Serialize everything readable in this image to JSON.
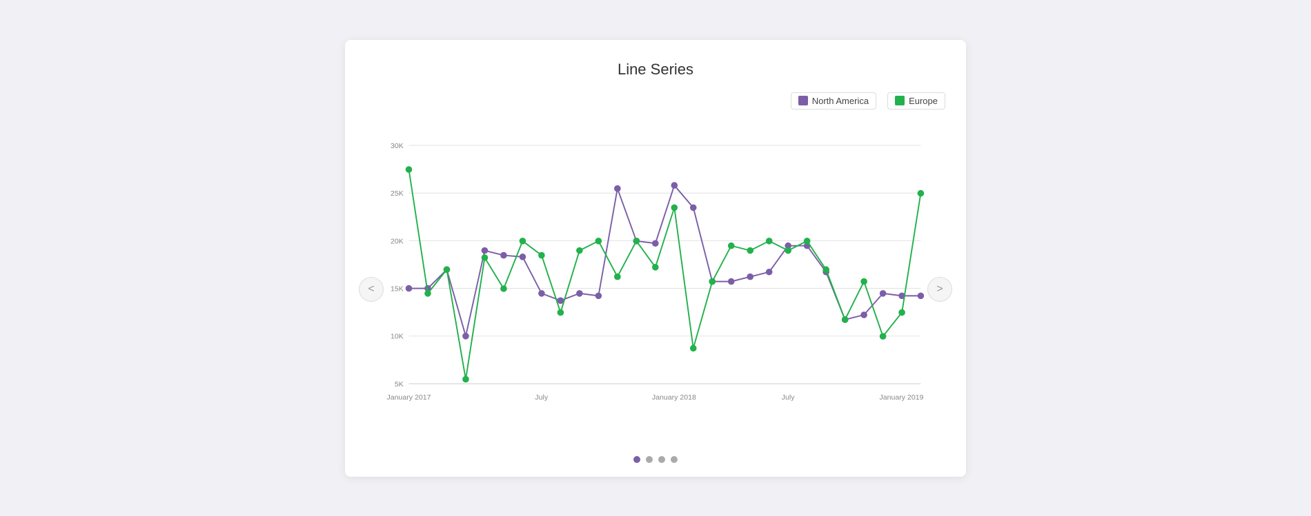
{
  "chart": {
    "title": "Line Series",
    "legend": {
      "north_america_label": "North America",
      "europe_label": "Europe",
      "north_america_color": "#7b5ea7",
      "europe_color": "#22b14c"
    },
    "yAxis": {
      "labels": [
        "30K",
        "25K",
        "20K",
        "15K",
        "10K",
        "5K"
      ],
      "values": [
        30000,
        25000,
        20000,
        15000,
        10000,
        5000
      ]
    },
    "xAxis": {
      "labels": [
        "January 2017",
        "July",
        "January 2018",
        "July",
        "January 2019",
        ""
      ]
    },
    "nav_prev": "<",
    "nav_next": ">",
    "pagination_dots": [
      {
        "active": true
      },
      {
        "active": false
      },
      {
        "active": false
      },
      {
        "active": false
      }
    ]
  }
}
